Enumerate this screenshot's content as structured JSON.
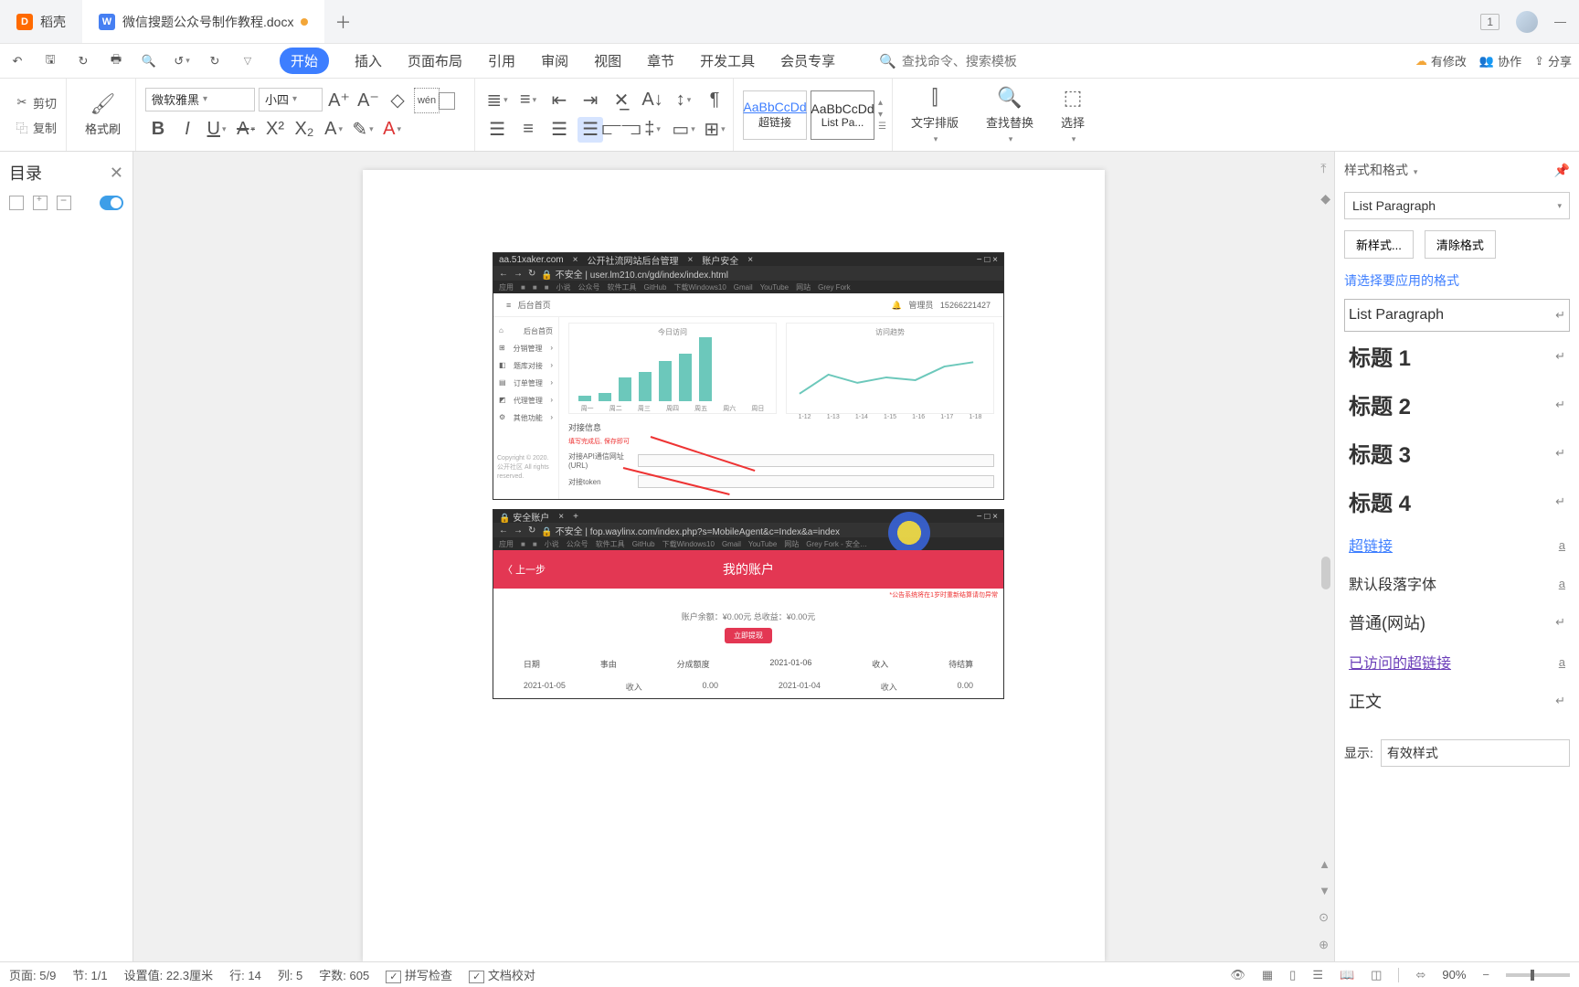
{
  "tabs": {
    "tab1": "稻壳",
    "tab2": "微信搜题公众号制作教程.docx"
  },
  "titlebar": {
    "page_ind": "1"
  },
  "qa": {
    "has_changes": "有修改",
    "collab": "协作",
    "share": "分享"
  },
  "menu": {
    "start": "开始",
    "insert": "插入",
    "page_layout": "页面布局",
    "reference": "引用",
    "review": "审阅",
    "view": "视图",
    "chapter": "章节",
    "dev_tools": "开发工具",
    "member": "会员专享",
    "search_placeholder": "查找命令、搜索模板"
  },
  "ribbon": {
    "cut": "剪切",
    "copy": "复制",
    "brush": "格式刷",
    "font_name": "微软雅黑",
    "font_size": "小四",
    "style1_preview": "AaBbCcDd",
    "style1_label": "超链接",
    "style2_preview": "AaBbCcDd",
    "style2_label": "List Pa...",
    "text_layout": "文字排版",
    "find_replace": "查找替换",
    "select": "选择",
    "wen": "wén"
  },
  "toc": {
    "title": "目录"
  },
  "styles_pane": {
    "title": "样式和格式",
    "current": "List Paragraph",
    "new_style": "新样式...",
    "clear_format": "清除格式",
    "hint": "请选择要应用的格式",
    "items": {
      "list_para": "List Paragraph",
      "h1": "标题 1",
      "h2": "标题 2",
      "h3": "标题 3",
      "h4": "标题 4",
      "hyper": "超链接",
      "default_font": "默认段落字体",
      "normal_web": "普通(网站)",
      "visited": "已访问的超链接",
      "body": "正文"
    },
    "show_label": "显示:",
    "show_value": "有效样式"
  },
  "embedded1": {
    "page_title": "后台首页",
    "side": [
      "后台首页",
      "分销管理",
      "题库对接",
      "订单管理",
      "代理管理",
      "其他功能"
    ],
    "copyright": "Copyright © 2020. 公开社区 All rights reserved.",
    "form_title": "对接信息",
    "form_hint": "填写完成后, 保存即可",
    "row1": "对接API通信网址(URL)",
    "row2": "对接token"
  },
  "chart_data": [
    {
      "type": "bar",
      "title": "今日访问",
      "categories": [
        "周一",
        "周二",
        "周三",
        "周四",
        "周五",
        "周六",
        "周日"
      ],
      "values": [
        100,
        150,
        450,
        550,
        750,
        900,
        1200
      ],
      "ylim": [
        0,
        1200
      ]
    },
    {
      "type": "line",
      "title": "访问趋势",
      "x": [
        "1-12",
        "1-13",
        "1-14",
        "1-15",
        "1-16",
        "1-17",
        "1-18"
      ],
      "values": [
        20,
        55,
        40,
        50,
        45,
        70,
        78
      ],
      "ylim": [
        0,
        100
      ]
    }
  ],
  "embedded2": {
    "back": "上一步",
    "title": "我的账户",
    "stats": "账户余额：¥0.00元   总收益：¥0.00元",
    "table": {
      "headers": [
        "日期",
        "事由",
        "分成额度",
        "2021-01-06",
        "收入",
        "待结算"
      ],
      "row": [
        "2021-01-05",
        "收入",
        "0.00",
        "2021-01-04",
        "收入",
        "0.00"
      ]
    }
  },
  "statusbar": {
    "page": "页面: 5/9",
    "section": "节: 1/1",
    "pos": "设置值: 22.3厘米",
    "line": "行: 14",
    "col": "列: 5",
    "words": "字数: 605",
    "spell": "拼写检查",
    "proof": "文档校对",
    "zoom": "90%"
  }
}
